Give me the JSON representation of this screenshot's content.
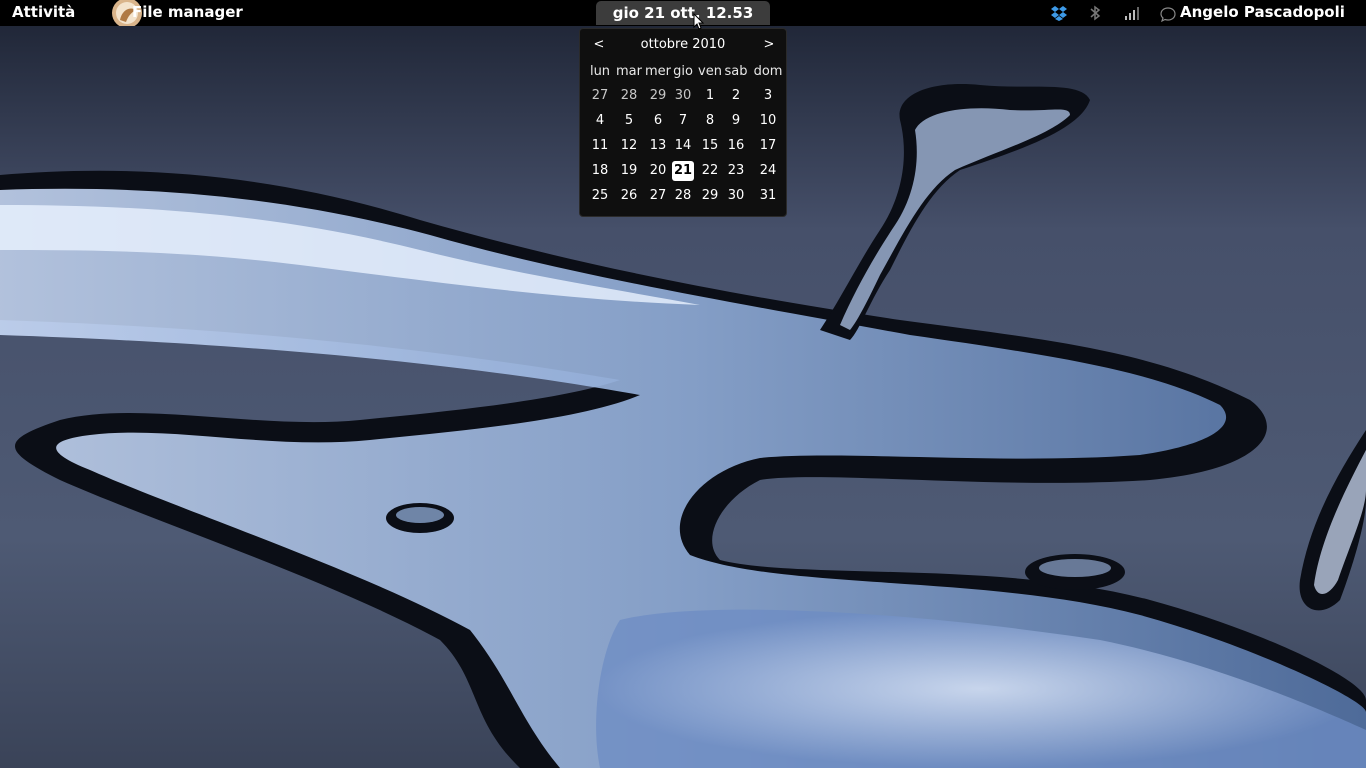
{
  "panel": {
    "activities_label": "Attività",
    "app_menu_label": "File manager",
    "clock_label": "gio 21 ott, 12.53",
    "user_name": "Angelo Pascadopoli",
    "tray_icons": [
      "dropbox-icon",
      "bluetooth-icon",
      "network-signal-icon"
    ]
  },
  "calendar": {
    "prev_label": "<",
    "next_label": ">",
    "month_title": "ottobre 2010",
    "weekdays": [
      "lun",
      "mar",
      "mer",
      "gio",
      "ven",
      "sab",
      "dom"
    ],
    "weeks": [
      [
        "27",
        "28",
        "29",
        "30",
        "1",
        "2",
        "3"
      ],
      [
        "4",
        "5",
        "6",
        "7",
        "8",
        "9",
        "10"
      ],
      [
        "11",
        "12",
        "13",
        "14",
        "15",
        "16",
        "17"
      ],
      [
        "18",
        "19",
        "20",
        "21",
        "22",
        "23",
        "24"
      ],
      [
        "25",
        "26",
        "27",
        "28",
        "29",
        "30",
        "31"
      ]
    ],
    "today": "21"
  },
  "colors": {
    "panel_bg": "#000000",
    "dropbox_blue": "#3d9ae8",
    "popup_bg": "#0f0f0f"
  }
}
